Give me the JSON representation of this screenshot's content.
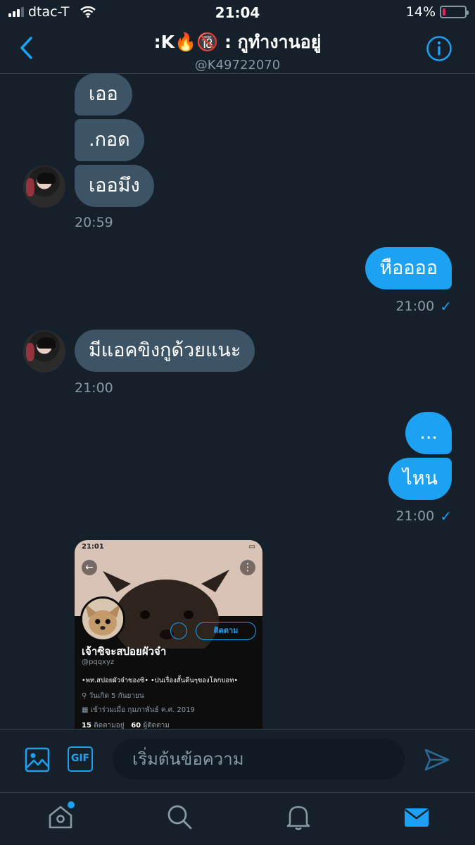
{
  "status_bar": {
    "carrier": "dtac-T",
    "time": "21:04",
    "battery_percent": "14%",
    "battery_level": 0.14
  },
  "header": {
    "title": ":K🔥🔞 : กูทำงานอยู่",
    "handle": "@K49722070"
  },
  "messages": {
    "in_1": "เออ",
    "in_2": ".กอด",
    "in_3": "เออมึง",
    "ts_1": "20:59",
    "out_1": "หืออออ",
    "ts_2": "21:00",
    "in_4": "มีแอคขิงกูด้วยแนะ",
    "ts_3": "21:00",
    "out_2": "...",
    "out_3": "ไหน",
    "ts_4": "21:00",
    "check": "✓"
  },
  "embedded_profile": {
    "status_time": "21:01",
    "follow_label": "ติดตาม",
    "name": "เจ้าซิจะสปอยผัวจ๋า",
    "handle": "@pqqxyz",
    "bio": "•พท.สปอยผัวจ๋าของซิ• •ปนเรื่องสั้นดีนๆของโลกบอท•",
    "birthday": "วันเกิด 5 กันยายน",
    "joined": "เข้าร่วมเมื่อ กุมภาพันธ์ ค.ศ. 2019",
    "following_count": "15",
    "following_label": "ติดตามอยู่",
    "followers_count": "60",
    "followers_label": "ผู้ติดตาม"
  },
  "composer": {
    "gif_label": "GIF",
    "placeholder": "เริ่มต้นข้อความ"
  },
  "colors": {
    "background": "#15202b",
    "accent": "#1da1f2",
    "incoming_bubble": "#3d5466",
    "muted": "#8899a6"
  }
}
